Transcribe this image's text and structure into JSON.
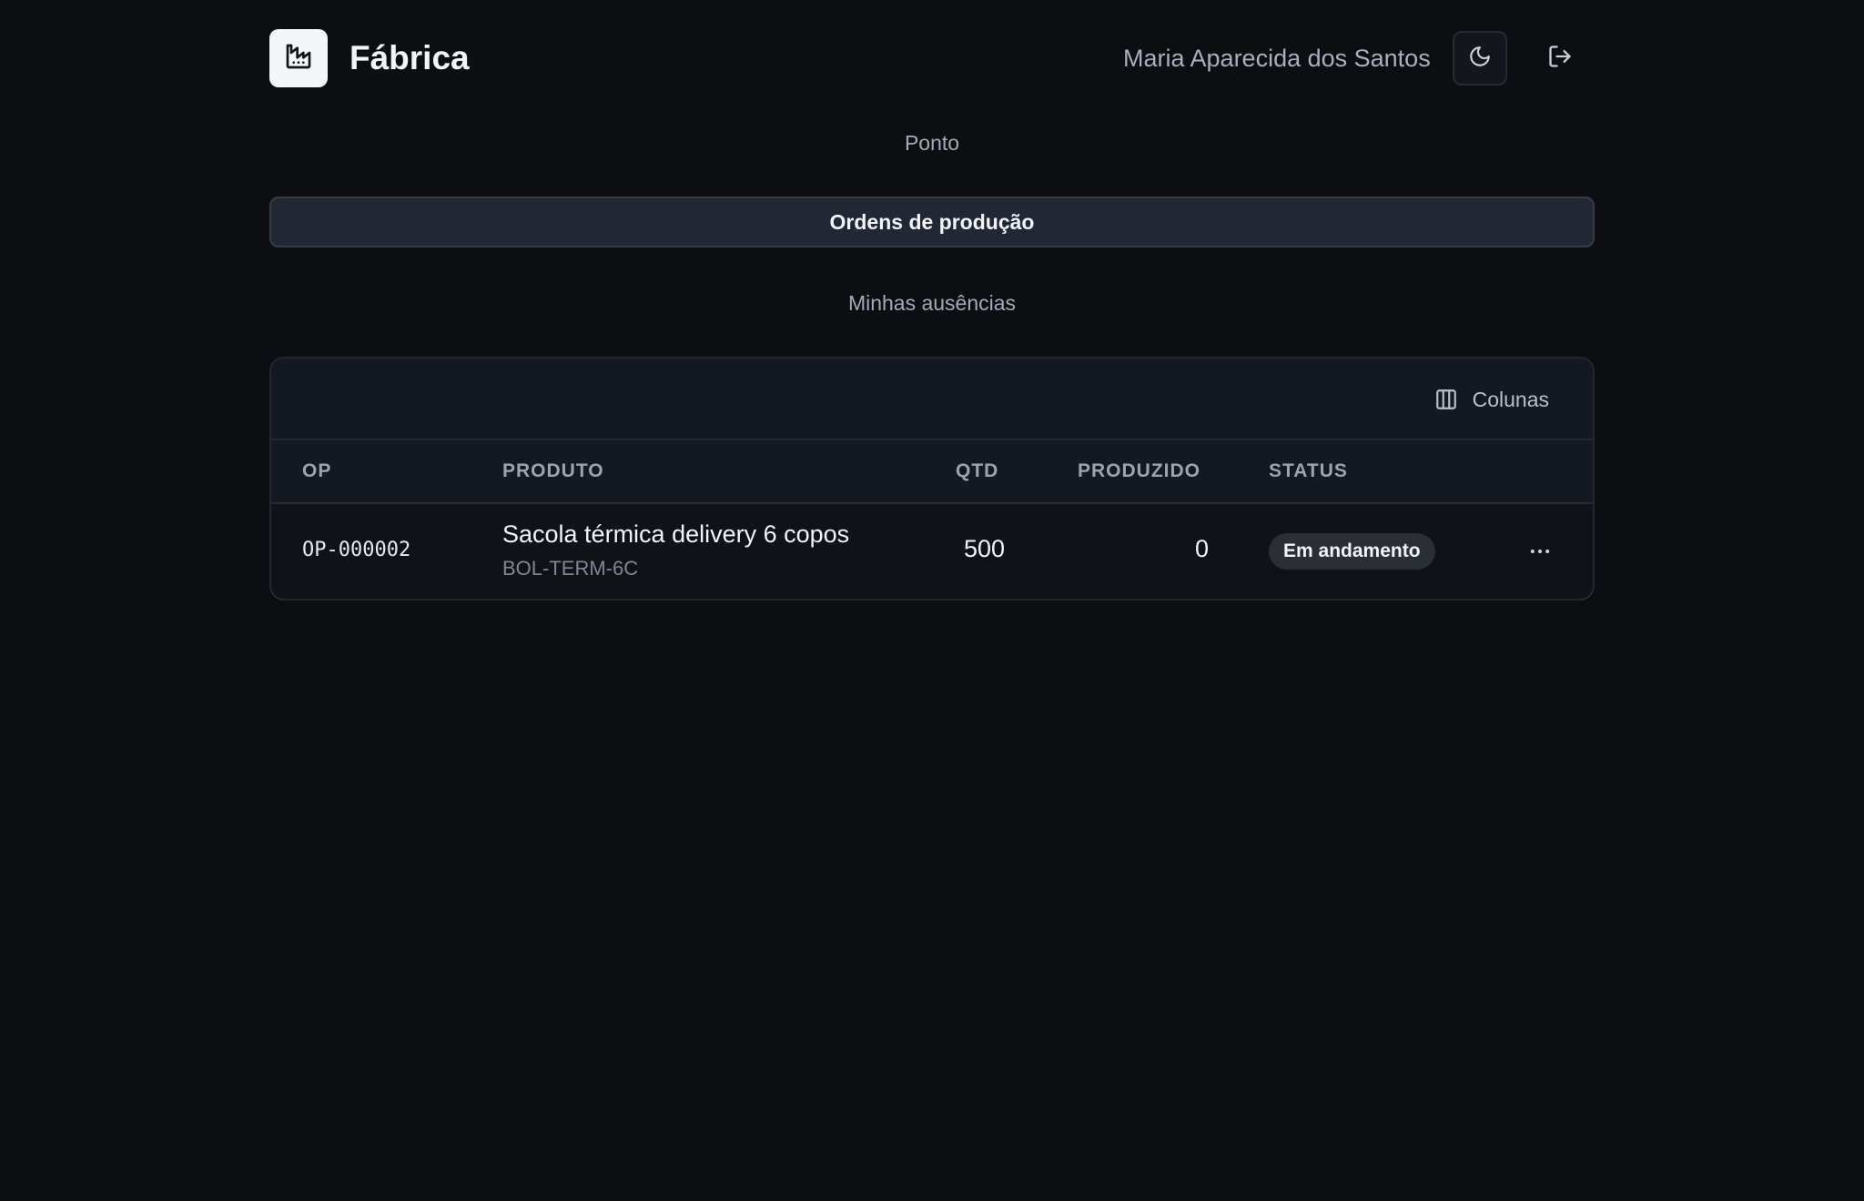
{
  "header": {
    "app_title": "Fábrica",
    "logo_icon": "factory-icon",
    "user_name": "Maria Aparecida dos Santos",
    "theme_icon": "moon-icon",
    "logout_icon": "logout-icon"
  },
  "nav": {
    "items": [
      {
        "label": "Ponto",
        "active": false
      },
      {
        "label": "Ordens de produção",
        "active": true
      },
      {
        "label": "Minhas ausências",
        "active": false
      }
    ]
  },
  "table": {
    "toolbar": {
      "columns_label": "Colunas",
      "columns_icon": "columns-icon"
    },
    "headers": [
      "OP",
      "PRODUTO",
      "QTD",
      "PRODUZIDO",
      "STATUS"
    ],
    "rows": [
      {
        "op": "OP-000002",
        "produto": "Sacola térmica delivery 6 copos",
        "sku": "BOL-TERM-6C",
        "qtd": "500",
        "produzido": "0",
        "status": "Em andamento",
        "menu_icon": "more-horizontal-icon"
      }
    ]
  },
  "colors": {
    "background": "#0c0e12",
    "card": "#141820",
    "active_tab": "#212834",
    "status_badge": "#2a2e35"
  }
}
